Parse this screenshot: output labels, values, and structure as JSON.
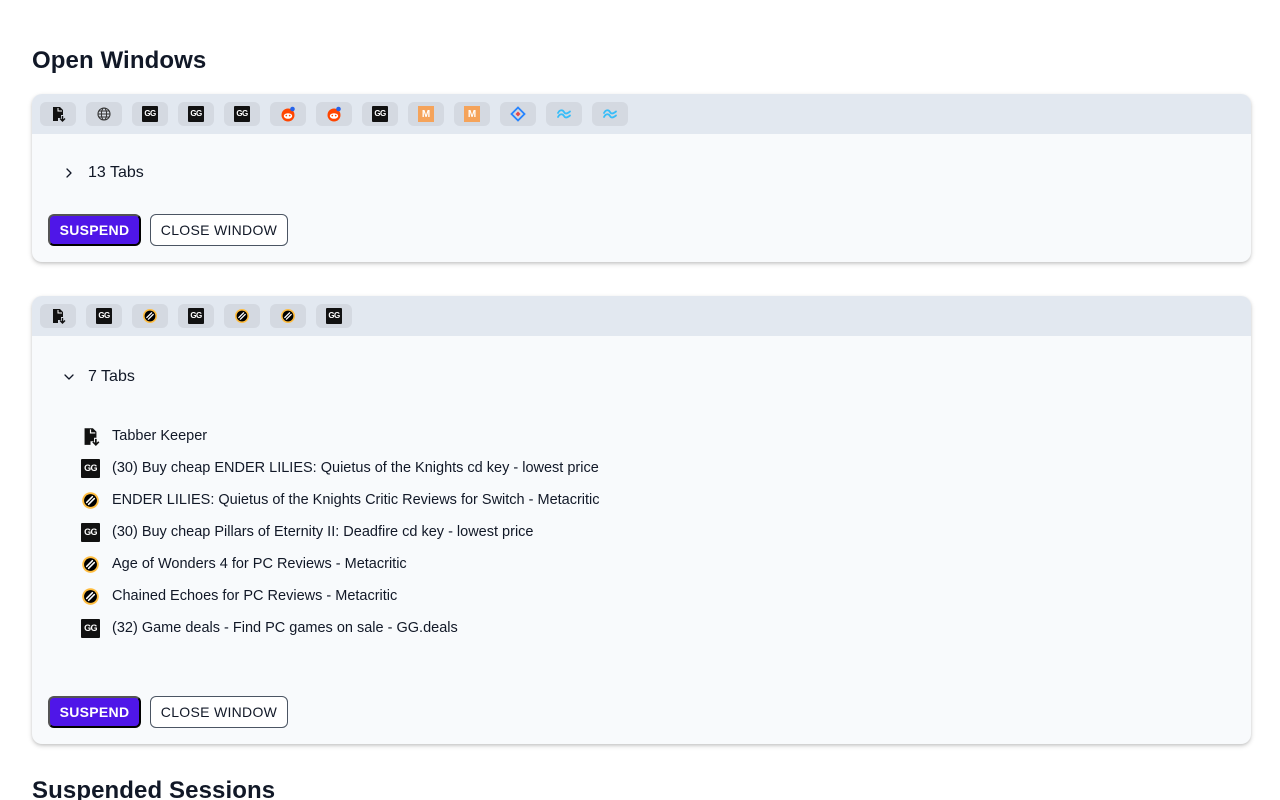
{
  "headings": {
    "open_windows": "Open Windows",
    "suspended_sessions": "Suspended Sessions"
  },
  "windows": [
    {
      "favicons": [
        "tabber-keeper-icon",
        "globe-icon",
        "ggdeals-icon",
        "ggdeals-icon",
        "ggdeals-icon",
        "reddit-icon",
        "reddit-icon",
        "ggdeals-icon",
        "m-logo-icon",
        "m-logo-icon",
        "jira-icon",
        "tailwind-icon",
        "tailwind-icon"
      ],
      "tab_count_label": "13 Tabs",
      "expanded": false,
      "suspend_label": "SUSPEND",
      "close_label": "CLOSE WINDOW"
    },
    {
      "favicons": [
        "tabber-keeper-icon",
        "ggdeals-icon",
        "metacritic-icon",
        "ggdeals-icon",
        "metacritic-icon",
        "metacritic-icon",
        "ggdeals-icon"
      ],
      "tab_count_label": "7 Tabs",
      "expanded": true,
      "tabs": [
        {
          "icon": "tabber-keeper-icon",
          "title": "Tabber Keeper"
        },
        {
          "icon": "ggdeals-icon",
          "title": "(30) Buy cheap ENDER LILIES: Quietus of the Knights cd key - lowest price"
        },
        {
          "icon": "metacritic-icon",
          "title": "ENDER LILIES: Quietus of the Knights Critic Reviews for Switch - Metacritic"
        },
        {
          "icon": "ggdeals-icon",
          "title": "(30) Buy cheap Pillars of Eternity II: Deadfire cd key - lowest price"
        },
        {
          "icon": "metacritic-icon",
          "title": "Age of Wonders 4 for PC Reviews - Metacritic"
        },
        {
          "icon": "metacritic-icon",
          "title": "Chained Echoes for PC Reviews - Metacritic"
        },
        {
          "icon": "ggdeals-icon",
          "title": "(32) Game deals - Find PC games on sale - GG.deals"
        }
      ],
      "suspend_label": "SUSPEND",
      "close_label": "CLOSE WINDOW"
    }
  ],
  "icon_text": {
    "ggdeals": "GG",
    "m_logo": "M"
  },
  "colors": {
    "accent": "#4f16e8",
    "favicon_bar": "#e2e8f0",
    "card_bg": "#f8fafc"
  }
}
